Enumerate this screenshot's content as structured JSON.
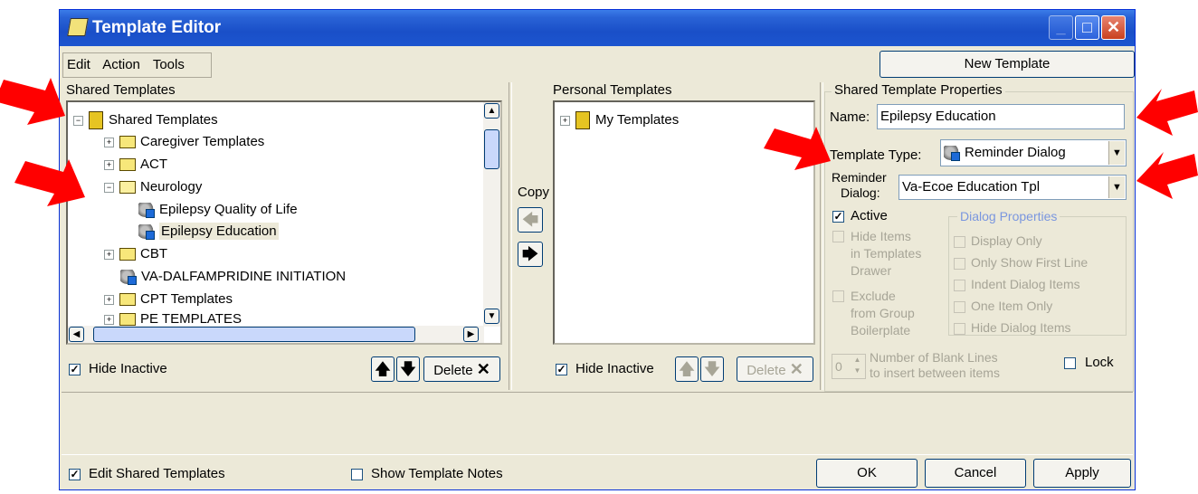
{
  "window": {
    "title": "Template Editor"
  },
  "menu": [
    "Edit",
    "Action",
    "Tools"
  ],
  "new_template_label": "New Template",
  "shared": {
    "heading": "Shared Templates",
    "root": "Shared Templates",
    "items": [
      {
        "label": "Caregiver Templates",
        "type": "folder"
      },
      {
        "label": "ACT",
        "type": "folder"
      },
      {
        "label": "Neurology",
        "type": "folder-open"
      },
      {
        "label": "Epilepsy Quality of Life",
        "type": "dialog"
      },
      {
        "label": "Epilepsy Education",
        "type": "dialog",
        "selected": true
      },
      {
        "label": "CBT",
        "type": "folder"
      },
      {
        "label": "VA-DALFAMPRIDINE INITIATION",
        "type": "dialog"
      },
      {
        "label": "CPT Templates",
        "type": "folder"
      },
      {
        "label": "PE TEMPLATES",
        "type": "folder"
      }
    ],
    "hide_inactive_label": "Hide Inactive",
    "hide_inactive_checked": true,
    "delete_label": "Delete"
  },
  "copy_label": "Copy",
  "personal": {
    "heading": "Personal Templates",
    "root": "My Templates",
    "hide_inactive_label": "Hide Inactive",
    "hide_inactive_checked": true,
    "delete_label": "Delete"
  },
  "properties": {
    "heading": "Shared Template Properties",
    "name_label": "Name:",
    "name_value": "Epilepsy Education",
    "type_label": "Template Type:",
    "type_value": "Reminder Dialog",
    "reminder_label_1": "Reminder",
    "reminder_label_2": "Dialog:",
    "reminder_value": "Va-Ecoe Education Tpl",
    "active_label": "Active",
    "active_checked": true,
    "hide_items_lines": [
      "Hide Items",
      "in Templates",
      "Drawer"
    ],
    "exclude_lines": [
      "Exclude",
      "from Group",
      "Boilerplate"
    ],
    "dialog_props_heading": "Dialog Properties",
    "dialog_props": [
      "Display Only",
      "Only Show First Line",
      "Indent Dialog Items",
      "One Item Only",
      "Hide Dialog Items"
    ],
    "blank_lines_value": "0",
    "blank_lines_label_1": "Number of Blank Lines",
    "blank_lines_label_2": "to insert between items",
    "lock_label": "Lock"
  },
  "footer": {
    "edit_shared_label": "Edit Shared Templates",
    "edit_shared_checked": true,
    "show_notes_label": "Show Template Notes",
    "ok_label": "OK",
    "cancel_label": "Cancel",
    "apply_label": "Apply"
  },
  "colors": {
    "title_bar": "#2a63d6",
    "annotation_arrow": "#ff0000",
    "window_bg": "#ece9d8"
  }
}
